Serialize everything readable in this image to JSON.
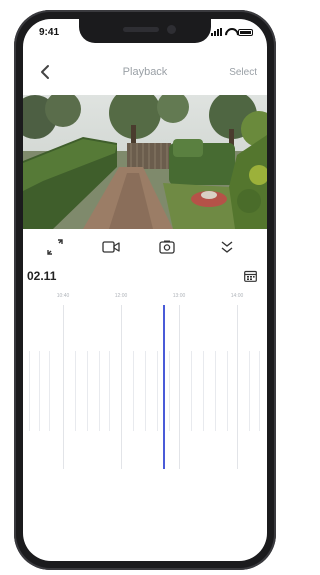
{
  "status": {
    "time": "9:41"
  },
  "header": {
    "title": "Playback",
    "select_label": "Select"
  },
  "toolbar": {
    "icons": [
      "fullscreen-icon",
      "record-icon",
      "snapshot-icon",
      "collapse-icon"
    ]
  },
  "date": {
    "label": "02.11"
  },
  "timeline": {
    "tick_labels": [
      "10:40",
      "12:00",
      "13:00",
      "14:00"
    ],
    "cursor_color": "#4a5bd8"
  },
  "colors": {
    "accent": "#4a5bd8",
    "muted_text": "#9aa0a6"
  }
}
